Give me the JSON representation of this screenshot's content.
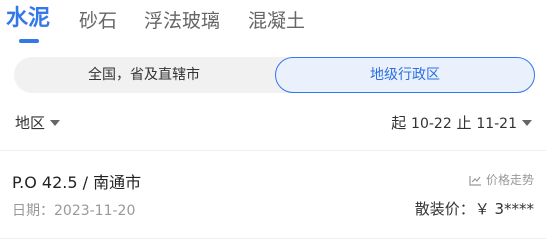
{
  "tabs": [
    {
      "label": "水泥",
      "active": true
    },
    {
      "label": "砂石",
      "active": false
    },
    {
      "label": "浮法玻璃",
      "active": false
    },
    {
      "label": "混凝土",
      "active": false
    }
  ],
  "segment": {
    "left_label": "全国，省及直辖市",
    "right_label": "地级行政区",
    "selected": "地级行政区"
  },
  "filters": {
    "region_label": "地区",
    "start_prefix": "起",
    "start_date": "10-22",
    "end_prefix": "止",
    "end_date": "11-21"
  },
  "item": {
    "title": "P.O 42.5 / 南通市",
    "date": "日期：2023-11-20",
    "trend_label": "价格走势",
    "price": "散装价：￥ 3****"
  },
  "colors": {
    "accent": "#3377e8"
  }
}
